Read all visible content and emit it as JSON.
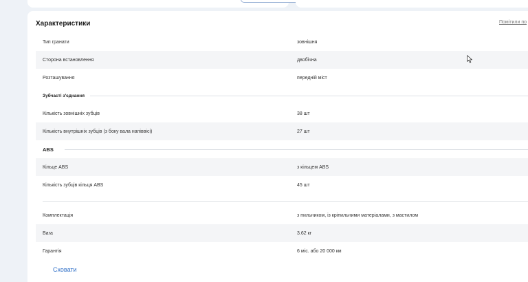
{
  "header": {
    "title": "Характеристики",
    "report_link": "Помітили по"
  },
  "rows_group_1": [
    {
      "label": "Тип гранати",
      "value": "зовнішня",
      "shaded": false
    },
    {
      "label": "Сторона встановлення",
      "value": "двобічна",
      "shaded": true
    },
    {
      "label": "Розташування",
      "value": "передній міст",
      "shaded": false
    }
  ],
  "section_splines": {
    "title": "Зубчасті з'єднання"
  },
  "rows_group_2": [
    {
      "label": "Кількість зовнішніх зубців",
      "value": "38 шт",
      "shaded": false
    },
    {
      "label": "Кількість внутрішніх зубців (з боку вала напіввісі)",
      "value": "27 шт",
      "shaded": true
    }
  ],
  "section_abs": {
    "title": "ABS"
  },
  "rows_group_3": [
    {
      "label": "Кільце ABS",
      "value": "з кільцем ABS",
      "shaded": true
    },
    {
      "label": "Кількість зубців кільця ABS",
      "value": "45 шт",
      "shaded": false
    }
  ],
  "rows_group_4": [
    {
      "label": "Комплектація",
      "value": "з пильником, із кріпильними матеріалами, з мастилом",
      "shaded": false
    },
    {
      "label": "Вага",
      "value": "3.62 кг",
      "shaded": true
    },
    {
      "label": "Гарантія",
      "value": "6 міс. або 20 000 км",
      "shaded": false
    }
  ],
  "footer": {
    "hide_label": "Сховати"
  },
  "colors": {
    "background": "#eef2f7",
    "card": "#ffffff",
    "row_shade": "#f4f5f7",
    "link": "#2f6fc7"
  }
}
